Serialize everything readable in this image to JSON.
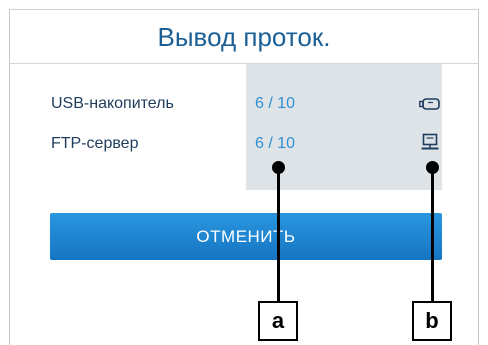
{
  "screen": {
    "title": "Вывод проток."
  },
  "destinations": [
    {
      "label": "USB-накопитель",
      "value": "6 / 10",
      "icon": "usb-drive-icon"
    },
    {
      "label": "FTP-сервер",
      "value": "6 / 10",
      "icon": "computer-icon"
    }
  ],
  "actions": {
    "cancel_label": "ОТМЕНИТЬ"
  },
  "callouts": {
    "a": "a",
    "b": "b"
  },
  "colors": {
    "title": "#1b5f95",
    "label": "#1e3c5c",
    "value": "#2f8fd0",
    "values_box": "#dee3e8",
    "button": "#1f86d2"
  }
}
